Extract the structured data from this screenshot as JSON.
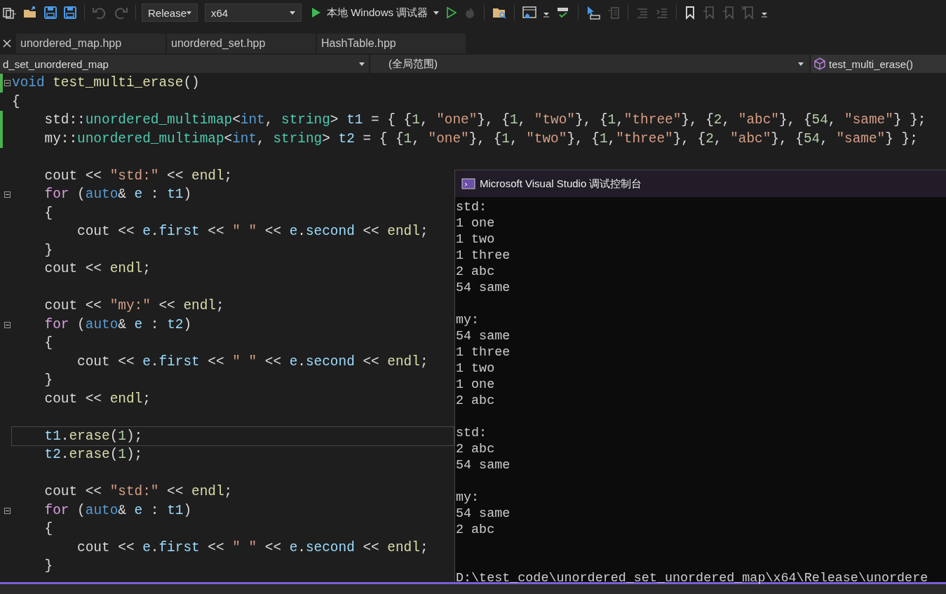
{
  "toolbar": {
    "configuration": "Release",
    "platform": "x64",
    "debugger": "本地 Windows 调试器"
  },
  "tabs": [
    {
      "label": "unordered_map.hpp",
      "selected": false
    },
    {
      "label": "unordered_set.hpp",
      "selected": false
    },
    {
      "label": "HashTable.hpp",
      "selected": false
    }
  ],
  "nav_bar": {
    "project": "d_set_unordered_map",
    "scope": "(全局范围)",
    "member": "test_multi_erase()"
  },
  "editor": {
    "lines": [
      {
        "kind": "code",
        "fold": true,
        "changed": true,
        "current": false,
        "tokens": [
          {
            "text": "void ",
            "kind": "kw"
          },
          {
            "text": "test_multi_erase",
            "kind": "fn"
          },
          {
            "text": "()",
            "kind": "plain"
          }
        ]
      },
      {
        "kind": "code",
        "fold": false,
        "changed": false,
        "current": false,
        "tokens": [
          {
            "text": "{",
            "kind": "plain"
          }
        ]
      },
      {
        "kind": "code",
        "fold": false,
        "changed": true,
        "current": false,
        "tokens": [
          {
            "text": "    std::",
            "kind": "plain"
          },
          {
            "text": "unordered_multimap",
            "kind": "type"
          },
          {
            "text": "<",
            "kind": "plain"
          },
          {
            "text": "int",
            "kind": "kw"
          },
          {
            "text": ", ",
            "kind": "plain"
          },
          {
            "text": "string",
            "kind": "type"
          },
          {
            "text": "> ",
            "kind": "plain"
          },
          {
            "text": "t1",
            "kind": "var"
          },
          {
            "text": " = { {",
            "kind": "plain"
          },
          {
            "text": "1",
            "kind": "num"
          },
          {
            "text": ", ",
            "kind": "plain"
          },
          {
            "text": "\"one\"",
            "kind": "str"
          },
          {
            "text": "}, {",
            "kind": "plain"
          },
          {
            "text": "1",
            "kind": "num"
          },
          {
            "text": ", ",
            "kind": "plain"
          },
          {
            "text": "\"two\"",
            "kind": "str"
          },
          {
            "text": "}, {",
            "kind": "plain"
          },
          {
            "text": "1",
            "kind": "num"
          },
          {
            "text": ",",
            "kind": "plain"
          },
          {
            "text": "\"three\"",
            "kind": "str"
          },
          {
            "text": "}, {",
            "kind": "plain"
          },
          {
            "text": "2",
            "kind": "num"
          },
          {
            "text": ", ",
            "kind": "plain"
          },
          {
            "text": "\"abc\"",
            "kind": "str"
          },
          {
            "text": "}, {",
            "kind": "plain"
          },
          {
            "text": "54",
            "kind": "num"
          },
          {
            "text": ", ",
            "kind": "plain"
          },
          {
            "text": "\"same\"",
            "kind": "str"
          },
          {
            "text": "} };",
            "kind": "plain"
          }
        ]
      },
      {
        "kind": "code",
        "fold": false,
        "changed": true,
        "current": false,
        "tokens": [
          {
            "text": "    my::",
            "kind": "plain"
          },
          {
            "text": "unordered_multimap",
            "kind": "type"
          },
          {
            "text": "<",
            "kind": "plain"
          },
          {
            "text": "int",
            "kind": "kw"
          },
          {
            "text": ", ",
            "kind": "plain"
          },
          {
            "text": "string",
            "kind": "type"
          },
          {
            "text": "> ",
            "kind": "plain"
          },
          {
            "text": "t2",
            "kind": "var"
          },
          {
            "text": " = { {",
            "kind": "plain"
          },
          {
            "text": "1",
            "kind": "num"
          },
          {
            "text": ", ",
            "kind": "plain"
          },
          {
            "text": "\"one\"",
            "kind": "str"
          },
          {
            "text": "}, {",
            "kind": "plain"
          },
          {
            "text": "1",
            "kind": "num"
          },
          {
            "text": ", ",
            "kind": "plain"
          },
          {
            "text": "\"two\"",
            "kind": "str"
          },
          {
            "text": "}, {",
            "kind": "plain"
          },
          {
            "text": "1",
            "kind": "num"
          },
          {
            "text": ",",
            "kind": "plain"
          },
          {
            "text": "\"three\"",
            "kind": "str"
          },
          {
            "text": "}, {",
            "kind": "plain"
          },
          {
            "text": "2",
            "kind": "num"
          },
          {
            "text": ", ",
            "kind": "plain"
          },
          {
            "text": "\"abc\"",
            "kind": "str"
          },
          {
            "text": "}, {",
            "kind": "plain"
          },
          {
            "text": "54",
            "kind": "num"
          },
          {
            "text": ", ",
            "kind": "plain"
          },
          {
            "text": "\"same\"",
            "kind": "str"
          },
          {
            "text": "} };",
            "kind": "plain"
          }
        ]
      },
      {
        "kind": "blank"
      },
      {
        "kind": "code",
        "fold": false,
        "changed": false,
        "current": false,
        "tokens": [
          {
            "text": "    cout << ",
            "kind": "plain"
          },
          {
            "text": "\"std:\"",
            "kind": "str"
          },
          {
            "text": " << ",
            "kind": "plain"
          },
          {
            "text": "endl",
            "kind": "fn"
          },
          {
            "text": ";",
            "kind": "plain"
          }
        ]
      },
      {
        "kind": "code",
        "fold": true,
        "changed": false,
        "current": false,
        "tokens": [
          {
            "text": "    for",
            "kind": "ctl"
          },
          {
            "text": " (",
            "kind": "plain"
          },
          {
            "text": "auto",
            "kind": "kw"
          },
          {
            "text": "& ",
            "kind": "plain"
          },
          {
            "text": "e",
            "kind": "var"
          },
          {
            "text": " : ",
            "kind": "plain"
          },
          {
            "text": "t1",
            "kind": "var"
          },
          {
            "text": ")",
            "kind": "plain"
          }
        ]
      },
      {
        "kind": "code",
        "fold": false,
        "changed": false,
        "current": false,
        "tokens": [
          {
            "text": "    {",
            "kind": "plain"
          }
        ]
      },
      {
        "kind": "code",
        "fold": false,
        "changed": false,
        "current": false,
        "tokens": [
          {
            "text": "        cout << ",
            "kind": "plain"
          },
          {
            "text": "e",
            "kind": "var"
          },
          {
            "text": ".",
            "kind": "plain"
          },
          {
            "text": "first",
            "kind": "var"
          },
          {
            "text": " << ",
            "kind": "plain"
          },
          {
            "text": "\" \"",
            "kind": "str"
          },
          {
            "text": " << ",
            "kind": "plain"
          },
          {
            "text": "e",
            "kind": "var"
          },
          {
            "text": ".",
            "kind": "plain"
          },
          {
            "text": "second",
            "kind": "var"
          },
          {
            "text": " << ",
            "kind": "plain"
          },
          {
            "text": "endl",
            "kind": "fn"
          },
          {
            "text": ";",
            "kind": "plain"
          }
        ]
      },
      {
        "kind": "code",
        "fold": false,
        "changed": false,
        "current": false,
        "tokens": [
          {
            "text": "    }",
            "kind": "plain"
          }
        ]
      },
      {
        "kind": "code",
        "fold": false,
        "changed": false,
        "current": false,
        "tokens": [
          {
            "text": "    cout << ",
            "kind": "plain"
          },
          {
            "text": "endl",
            "kind": "fn"
          },
          {
            "text": ";",
            "kind": "plain"
          }
        ]
      },
      {
        "kind": "blank"
      },
      {
        "kind": "code",
        "fold": false,
        "changed": false,
        "current": false,
        "tokens": [
          {
            "text": "    cout << ",
            "kind": "plain"
          },
          {
            "text": "\"my:\"",
            "kind": "str"
          },
          {
            "text": " << ",
            "kind": "plain"
          },
          {
            "text": "endl",
            "kind": "fn"
          },
          {
            "text": ";",
            "kind": "plain"
          }
        ]
      },
      {
        "kind": "code",
        "fold": true,
        "changed": false,
        "current": false,
        "tokens": [
          {
            "text": "    for",
            "kind": "ctl"
          },
          {
            "text": " (",
            "kind": "plain"
          },
          {
            "text": "auto",
            "kind": "kw"
          },
          {
            "text": "& ",
            "kind": "plain"
          },
          {
            "text": "e",
            "kind": "var"
          },
          {
            "text": " : ",
            "kind": "plain"
          },
          {
            "text": "t2",
            "kind": "var"
          },
          {
            "text": ")",
            "kind": "plain"
          }
        ]
      },
      {
        "kind": "code",
        "fold": false,
        "changed": false,
        "current": false,
        "tokens": [
          {
            "text": "    {",
            "kind": "plain"
          }
        ]
      },
      {
        "kind": "code",
        "fold": false,
        "changed": false,
        "current": false,
        "tokens": [
          {
            "text": "        cout << ",
            "kind": "plain"
          },
          {
            "text": "e",
            "kind": "var"
          },
          {
            "text": ".",
            "kind": "plain"
          },
          {
            "text": "first",
            "kind": "var"
          },
          {
            "text": " << ",
            "kind": "plain"
          },
          {
            "text": "\" \"",
            "kind": "str"
          },
          {
            "text": " << ",
            "kind": "plain"
          },
          {
            "text": "e",
            "kind": "var"
          },
          {
            "text": ".",
            "kind": "plain"
          },
          {
            "text": "second",
            "kind": "var"
          },
          {
            "text": " << ",
            "kind": "plain"
          },
          {
            "text": "endl",
            "kind": "fn"
          },
          {
            "text": ";",
            "kind": "plain"
          }
        ]
      },
      {
        "kind": "code",
        "fold": false,
        "changed": false,
        "current": false,
        "tokens": [
          {
            "text": "    }",
            "kind": "plain"
          }
        ]
      },
      {
        "kind": "code",
        "fold": false,
        "changed": false,
        "current": false,
        "tokens": [
          {
            "text": "    cout << ",
            "kind": "plain"
          },
          {
            "text": "endl",
            "kind": "fn"
          },
          {
            "text": ";",
            "kind": "plain"
          }
        ]
      },
      {
        "kind": "blank"
      },
      {
        "kind": "code",
        "fold": false,
        "changed": false,
        "current": true,
        "tokens": [
          {
            "text": "    t1",
            "kind": "var"
          },
          {
            "text": ".",
            "kind": "plain"
          },
          {
            "text": "erase",
            "kind": "fn"
          },
          {
            "text": "(",
            "kind": "plain"
          },
          {
            "text": "1",
            "kind": "num"
          },
          {
            "text": ");",
            "kind": "plain"
          }
        ]
      },
      {
        "kind": "code",
        "fold": false,
        "changed": false,
        "current": false,
        "tokens": [
          {
            "text": "    t2",
            "kind": "var"
          },
          {
            "text": ".",
            "kind": "plain"
          },
          {
            "text": "erase",
            "kind": "fn"
          },
          {
            "text": "(",
            "kind": "plain"
          },
          {
            "text": "1",
            "kind": "num"
          },
          {
            "text": ");",
            "kind": "plain"
          }
        ]
      },
      {
        "kind": "blank"
      },
      {
        "kind": "code",
        "fold": false,
        "changed": false,
        "current": false,
        "tokens": [
          {
            "text": "    cout << ",
            "kind": "plain"
          },
          {
            "text": "\"std:\"",
            "kind": "str"
          },
          {
            "text": " << ",
            "kind": "plain"
          },
          {
            "text": "endl",
            "kind": "fn"
          },
          {
            "text": ";",
            "kind": "plain"
          }
        ]
      },
      {
        "kind": "code",
        "fold": true,
        "changed": false,
        "current": false,
        "tokens": [
          {
            "text": "    for",
            "kind": "ctl"
          },
          {
            "text": " (",
            "kind": "plain"
          },
          {
            "text": "auto",
            "kind": "kw"
          },
          {
            "text": "& ",
            "kind": "plain"
          },
          {
            "text": "e",
            "kind": "var"
          },
          {
            "text": " : ",
            "kind": "plain"
          },
          {
            "text": "t1",
            "kind": "var"
          },
          {
            "text": ")",
            "kind": "plain"
          }
        ]
      },
      {
        "kind": "code",
        "fold": false,
        "changed": false,
        "current": false,
        "tokens": [
          {
            "text": "    {",
            "kind": "plain"
          }
        ]
      },
      {
        "kind": "code",
        "fold": false,
        "changed": false,
        "current": false,
        "tokens": [
          {
            "text": "        cout << ",
            "kind": "plain"
          },
          {
            "text": "e",
            "kind": "var"
          },
          {
            "text": ".",
            "kind": "plain"
          },
          {
            "text": "first",
            "kind": "var"
          },
          {
            "text": " << ",
            "kind": "plain"
          },
          {
            "text": "\" \"",
            "kind": "str"
          },
          {
            "text": " << ",
            "kind": "plain"
          },
          {
            "text": "e",
            "kind": "var"
          },
          {
            "text": ".",
            "kind": "plain"
          },
          {
            "text": "second",
            "kind": "var"
          },
          {
            "text": " << ",
            "kind": "plain"
          },
          {
            "text": "endl",
            "kind": "fn"
          },
          {
            "text": ";",
            "kind": "plain"
          }
        ]
      },
      {
        "kind": "code",
        "fold": false,
        "changed": false,
        "current": false,
        "tokens": [
          {
            "text": "    }",
            "kind": "plain"
          }
        ]
      }
    ]
  },
  "console": {
    "title": "Microsoft Visual Studio 调试控制台",
    "blocks": [
      {
        "kind": "output",
        "lines": [
          "std:",
          "1 one",
          "1 two",
          "1 three",
          "2 abc",
          "54 same"
        ]
      },
      {
        "kind": "output",
        "lines": [
          "my:",
          "54 same",
          "1 three",
          "1 two",
          "1 one",
          "2 abc"
        ]
      },
      {
        "kind": "output",
        "lines": [
          "std:",
          "2 abc",
          "54 same"
        ]
      },
      {
        "kind": "output",
        "lines": [
          "my:",
          "54 same",
          "2 abc"
        ]
      },
      {
        "kind": "exit",
        "lines": [
          "D:\\test_code\\unordered_set_unordered_map\\x64\\Release\\unordere"
        ]
      }
    ]
  }
}
